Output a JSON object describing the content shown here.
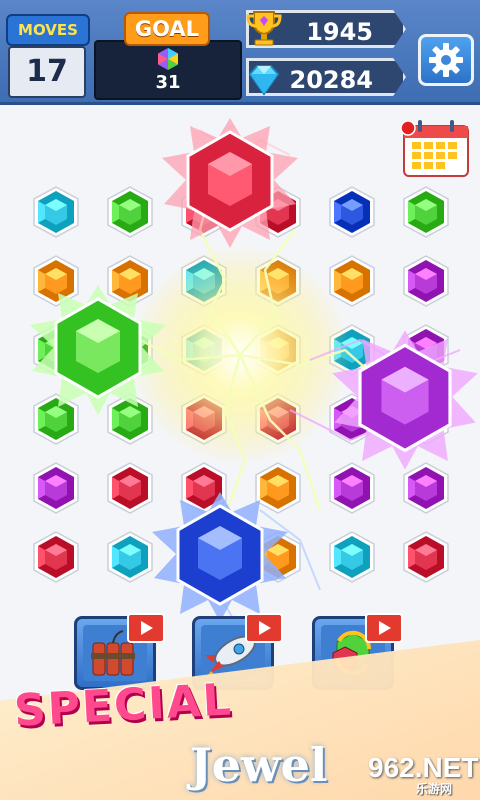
{
  "hud": {
    "moves_label": "MOVES",
    "moves_value": "17",
    "goal_label": "GOAL",
    "goal_count": "31",
    "goal_gem_icon": "rainbow-gem-icon",
    "trophy_score": "1945",
    "trophy_icon": "trophy-icon",
    "diamonds": "20284",
    "diamond_icon": "diamond-icon",
    "settings_icon": "gear-icon"
  },
  "calendar_icon": "calendar-icon",
  "colors": {
    "cyan": "#35c9e6",
    "green": "#4fd23b",
    "orange": "#ff9a1e",
    "purple": "#b83ad9",
    "red": "#e2354f",
    "blue": "#2f58e0",
    "yellow": "#ffd21e"
  },
  "grid": {
    "rows": [
      [
        "cyan",
        "green",
        "red",
        "red",
        "blue",
        "green"
      ],
      [
        "orange",
        "orange",
        "cyan",
        "orange",
        "orange",
        "purple"
      ],
      [
        "green",
        "green",
        "cyan",
        "orange",
        "cyan",
        "purple"
      ],
      [
        "green",
        "green",
        "red",
        "red",
        "purple",
        "purple"
      ],
      [
        "purple",
        "red",
        "red",
        "orange",
        "purple",
        "purple"
      ],
      [
        "red",
        "cyan",
        "blue",
        "orange",
        "cyan",
        "red"
      ]
    ]
  },
  "boosters": [
    {
      "name": "dynamite-booster",
      "icon": "dynamite-icon"
    },
    {
      "name": "rocket-booster",
      "icon": "rocket-icon"
    },
    {
      "name": "shuffle-booster",
      "icon": "shuffle-icon"
    }
  ],
  "banner": {
    "line1": "SPECIAL",
    "line2": "Jewel",
    "watermark": "962.NET",
    "watermark_sub": "乐游网"
  }
}
